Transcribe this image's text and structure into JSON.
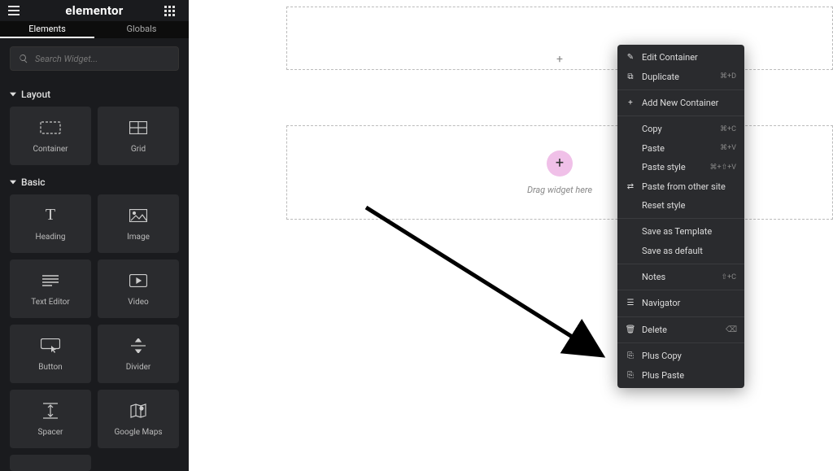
{
  "header": {
    "logo": "elementor"
  },
  "tabs": {
    "elements": "Elements",
    "globals": "Globals"
  },
  "search": {
    "placeholder": "Search Widget..."
  },
  "sections": {
    "layout": "Layout",
    "basic": "Basic"
  },
  "widgets": {
    "layout": [
      {
        "label": "Container",
        "icon": "container"
      },
      {
        "label": "Grid",
        "icon": "grid"
      }
    ],
    "basic": [
      {
        "label": "Heading",
        "icon": "heading"
      },
      {
        "label": "Image",
        "icon": "image"
      },
      {
        "label": "Text Editor",
        "icon": "text-editor"
      },
      {
        "label": "Video",
        "icon": "video"
      },
      {
        "label": "Button",
        "icon": "button"
      },
      {
        "label": "Divider",
        "icon": "divider"
      },
      {
        "label": "Spacer",
        "icon": "spacer"
      },
      {
        "label": "Google Maps",
        "icon": "maps"
      }
    ]
  },
  "canvas": {
    "drag_hint": "Drag widget here"
  },
  "context_menu": {
    "groups": [
      [
        {
          "label": "Edit Container",
          "icon": "pencil"
        },
        {
          "label": "Duplicate",
          "icon": "copy-stack",
          "shortcut": "⌘+D"
        }
      ],
      [
        {
          "label": "Add New Container",
          "icon": "plus"
        }
      ],
      [
        {
          "label": "Copy",
          "no_icon": true,
          "shortcut": "⌘+C"
        },
        {
          "label": "Paste",
          "no_icon": true,
          "shortcut": "⌘+V"
        },
        {
          "label": "Paste style",
          "no_icon": true,
          "shortcut": "⌘+⇧+V"
        },
        {
          "label": "Paste from other site",
          "icon": "transfer"
        },
        {
          "label": "Reset style",
          "no_icon": true
        }
      ],
      [
        {
          "label": "Save as Template",
          "no_icon": true
        },
        {
          "label": "Save as default",
          "no_icon": true
        }
      ],
      [
        {
          "label": "Notes",
          "no_icon": true,
          "shortcut": "⇧+C"
        }
      ],
      [
        {
          "label": "Navigator",
          "icon": "layers"
        }
      ],
      [
        {
          "label": "Delete",
          "icon": "trash",
          "trail": "⌫"
        }
      ],
      [
        {
          "label": "Plus Copy",
          "icon": "copy-sheet"
        },
        {
          "label": "Plus Paste",
          "icon": "copy-sheet"
        }
      ]
    ]
  }
}
